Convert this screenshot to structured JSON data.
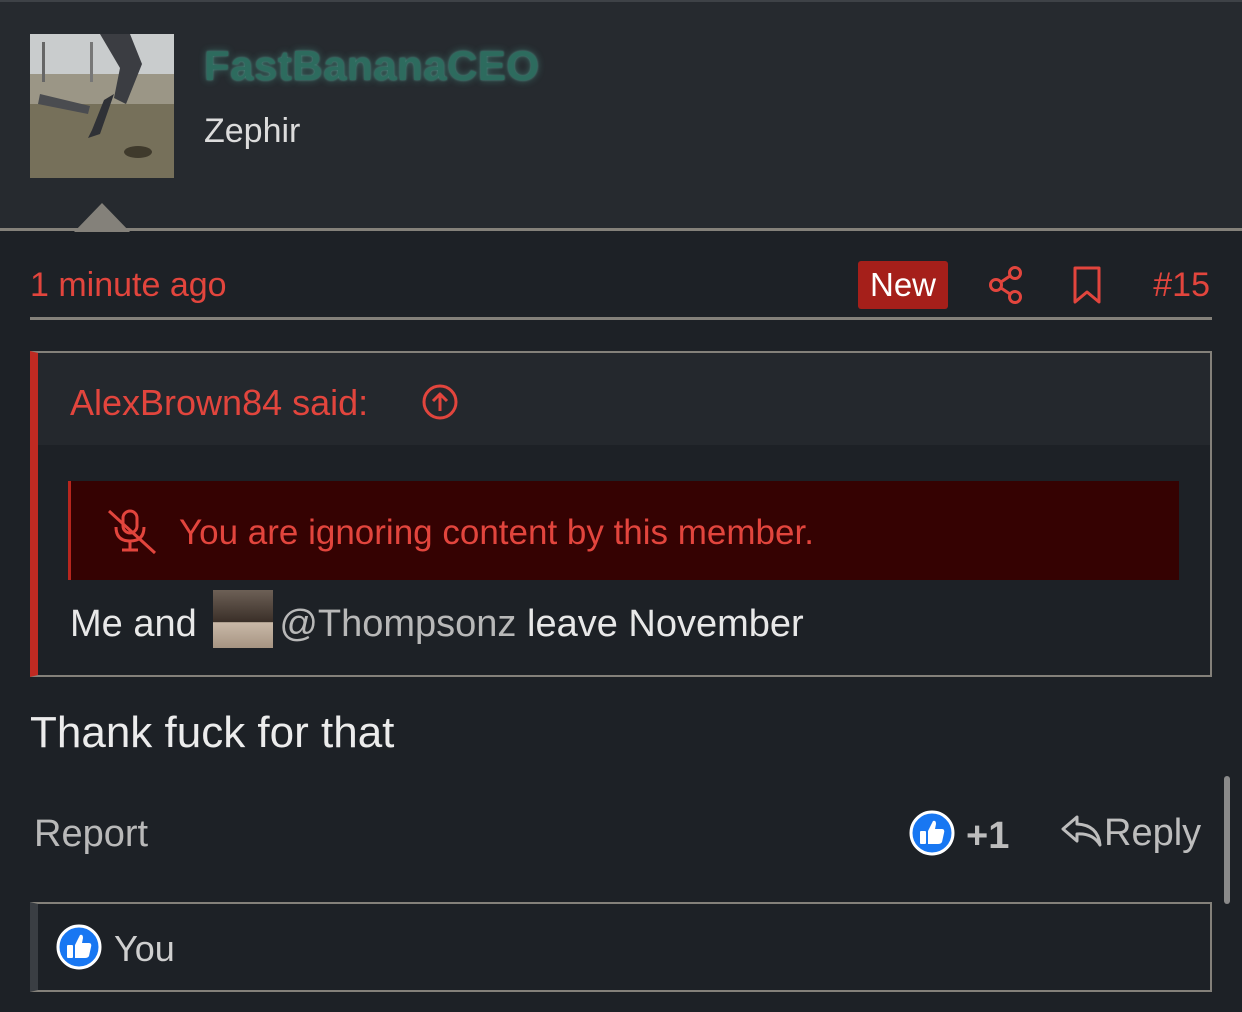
{
  "user": {
    "username": "FastBananaCEO",
    "title": "Zephir"
  },
  "post": {
    "time": "1 minute ago",
    "new_badge": "New",
    "number": "#15",
    "body": "Thank fuck for that"
  },
  "quote": {
    "author_line": "AlexBrown84 said:",
    "ignore_notice": "You are ignoring content by this member.",
    "text_before": "Me and",
    "mention": "@Thompsonz",
    "text_after": "leave November"
  },
  "actions": {
    "report": "Report",
    "like_count": "+1",
    "reply": "Reply"
  },
  "reactions": {
    "user": "You"
  },
  "colors": {
    "accent_red": "#e2453d",
    "badge_red": "#a51f1a",
    "ignore_bg": "#350202",
    "username_green": "#2d6b5e",
    "like_blue": "#1877f2"
  },
  "icons": [
    "share-icon",
    "bookmark-icon",
    "arrow-up-circle-icon",
    "mic-off-icon",
    "thumbs-up-icon",
    "reply-arrow-icon"
  ]
}
